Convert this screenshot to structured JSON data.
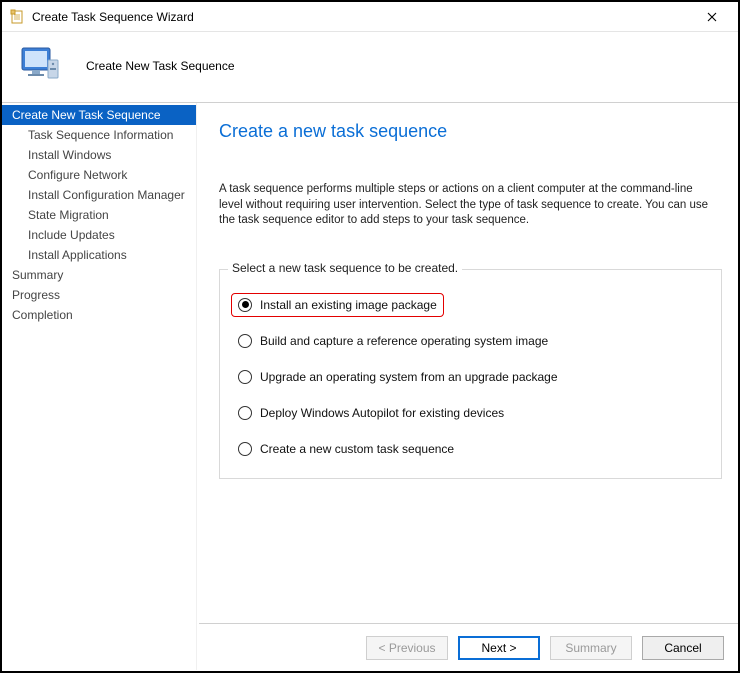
{
  "window": {
    "title": "Create Task Sequence Wizard"
  },
  "header": {
    "title": "Create New Task Sequence"
  },
  "sidebar": {
    "items": [
      {
        "label": "Create New Task Sequence",
        "indent": false,
        "active": true
      },
      {
        "label": "Task Sequence Information",
        "indent": true,
        "active": false
      },
      {
        "label": "Install Windows",
        "indent": true,
        "active": false
      },
      {
        "label": "Configure Network",
        "indent": true,
        "active": false
      },
      {
        "label": "Install Configuration Manager",
        "indent": true,
        "active": false
      },
      {
        "label": "State Migration",
        "indent": true,
        "active": false
      },
      {
        "label": "Include Updates",
        "indent": true,
        "active": false
      },
      {
        "label": "Install Applications",
        "indent": true,
        "active": false
      },
      {
        "label": "Summary",
        "indent": false,
        "active": false
      },
      {
        "label": "Progress",
        "indent": false,
        "active": false
      },
      {
        "label": "Completion",
        "indent": false,
        "active": false
      }
    ]
  },
  "page": {
    "title": "Create a new task sequence",
    "description": "A task sequence performs multiple steps or actions on a client computer at the command-line level without requiring user intervention. Select the type of task sequence to create. You can use the task sequence editor to add steps to your task sequence.",
    "fieldset_legend": "Select a new task sequence to be created.",
    "options": [
      {
        "label": "Install an existing image package",
        "checked": true,
        "highlight": true
      },
      {
        "label": "Build and capture a reference operating system image",
        "checked": false,
        "highlight": false
      },
      {
        "label": "Upgrade an operating system from an upgrade package",
        "checked": false,
        "highlight": false
      },
      {
        "label": "Deploy Windows Autopilot for existing devices",
        "checked": false,
        "highlight": false
      },
      {
        "label": "Create a new custom task sequence",
        "checked": false,
        "highlight": false
      }
    ]
  },
  "footer": {
    "previous": "< Previous",
    "next": "Next >",
    "summary": "Summary",
    "cancel": "Cancel"
  }
}
